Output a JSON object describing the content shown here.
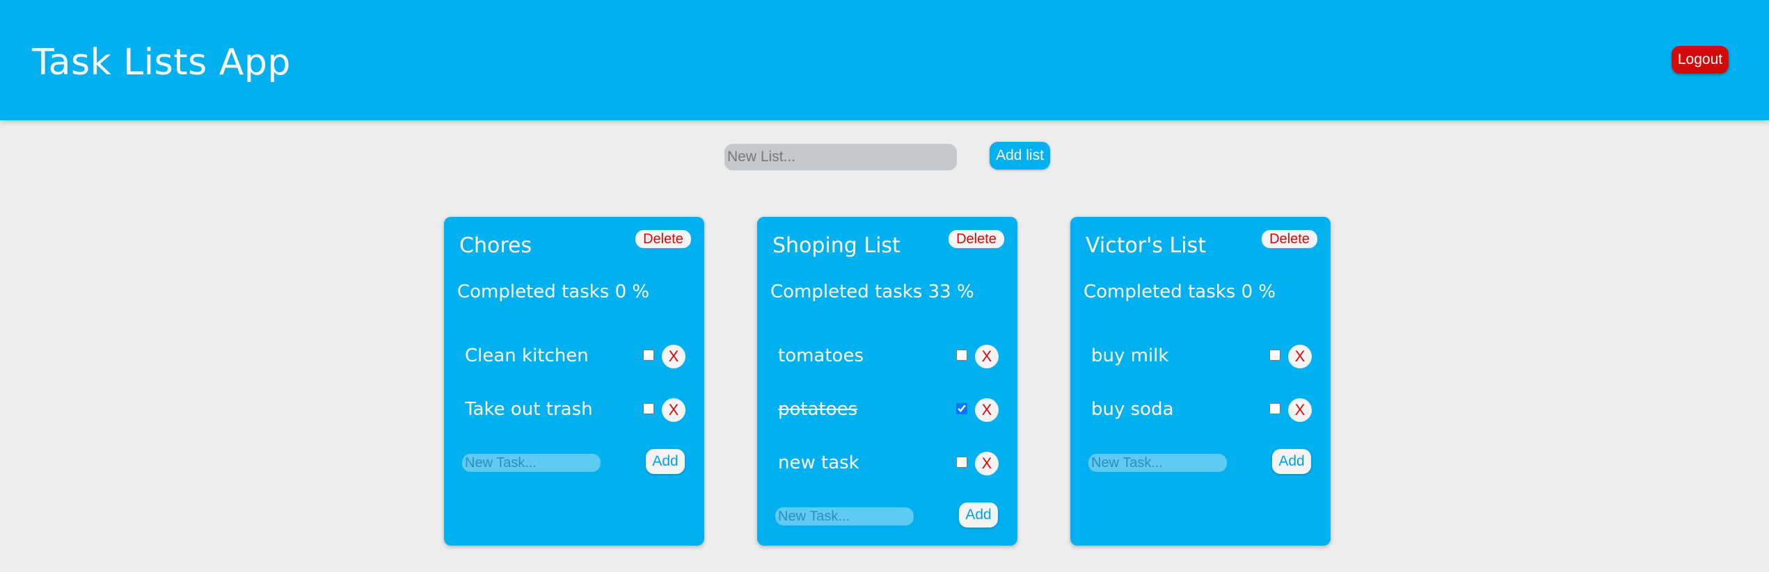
{
  "header": {
    "title": "Task Lists App",
    "logout_label": "Logout"
  },
  "new_list": {
    "placeholder": "New List...",
    "button_label": "Add list"
  },
  "lists": [
    {
      "title": "Chores",
      "delete_label": "Delete",
      "progress": "Completed tasks 0 %",
      "tasks": [
        {
          "label": "Clean kitchen",
          "done": false
        },
        {
          "label": "Take out trash",
          "done": false
        }
      ],
      "new_task_placeholder": "New Task...",
      "add_label": "Add"
    },
    {
      "title": "Shoping List",
      "delete_label": "Delete",
      "progress": "Completed tasks 33 %",
      "tasks": [
        {
          "label": "tomatoes",
          "done": false
        },
        {
          "label": "potatoes",
          "done": true
        },
        {
          "label": "new task",
          "done": false
        }
      ],
      "new_task_placeholder": "New Task...",
      "add_label": "Add"
    },
    {
      "title": "Victor's List",
      "delete_label": "Delete",
      "progress": "Completed tasks 0 %",
      "tasks": [
        {
          "label": "buy milk",
          "done": false
        },
        {
          "label": "buy soda",
          "done": false
        }
      ],
      "new_task_placeholder": "New Task...",
      "add_label": "Add"
    }
  ],
  "task_delete_label": "X",
  "colors": {
    "primary": "#02b0f0",
    "danger": "#d10a0a",
    "background": "#ededed"
  }
}
